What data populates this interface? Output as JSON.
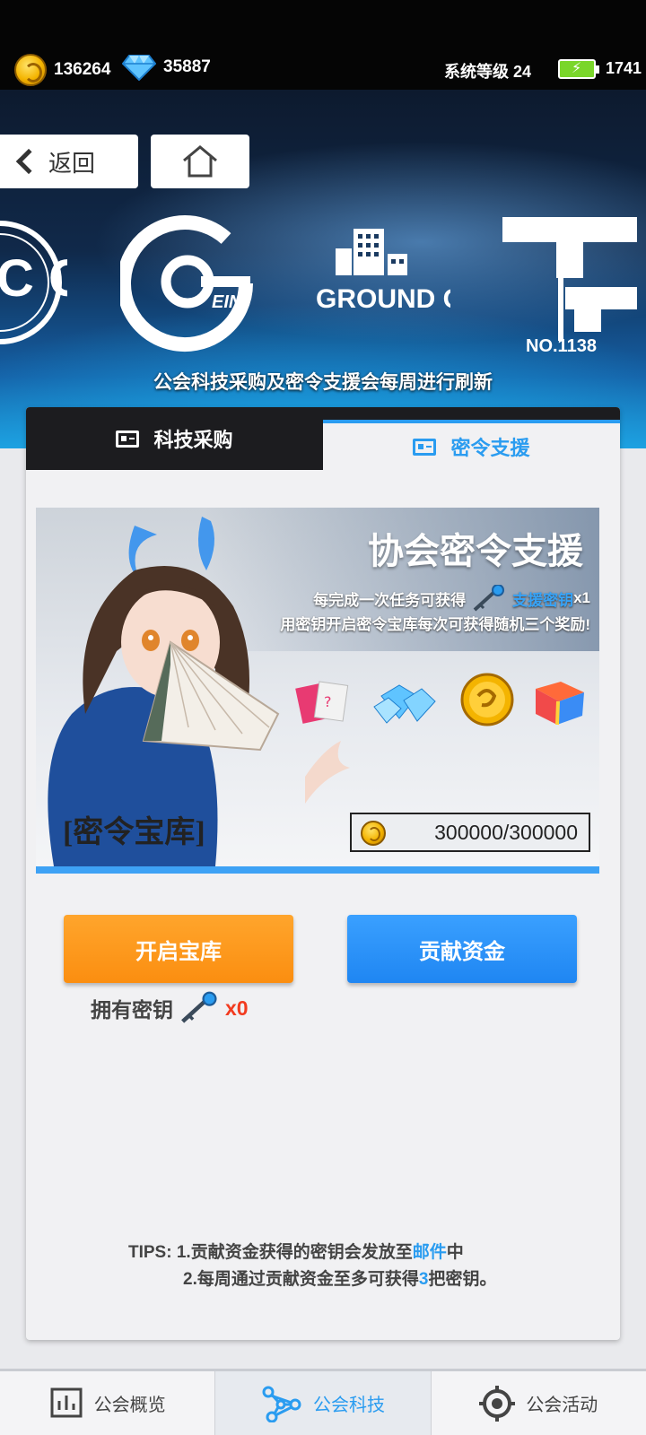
{
  "status": {
    "gold": "136264",
    "diamonds": "35887",
    "system_level": "系统等级 24",
    "energy": "1741"
  },
  "header": {
    "back_label": "返回",
    "notice": "公会科技采购及密令支援会每周进行刷新",
    "logos": [
      "C COLLEGE",
      "EIN",
      "GROUND GRAY.",
      "NO.1138"
    ]
  },
  "tabs": [
    {
      "label": "科技采购",
      "active": false
    },
    {
      "label": "密令支援",
      "active": true
    }
  ],
  "vault": {
    "title": "协会密令支援",
    "line1_prefix": "每完成一次任务可获得",
    "line1_item": "支援密钥",
    "line1_suffix": "x1",
    "line2": "用密钥开启密令宝库每次可获得随机三个奖励!",
    "name": "[密令宝库]",
    "fund_progress": "300000/300000",
    "fund_current": 300000,
    "fund_max": 300000
  },
  "actions": {
    "open_label": "开启宝库",
    "contribute_label": "贡献资金",
    "owned_label": "拥有密钥",
    "owned_count": "x0"
  },
  "tips": {
    "prefix": "TIPS:",
    "line1_a": "1.贡献资金获得的密钥会发放至",
    "line1_link": "邮件",
    "line1_b": "中",
    "line2_a": "2.每周通过贡献资金至多可获得",
    "line2_num": "3",
    "line2_b": "把密钥。"
  },
  "bottom_nav": [
    {
      "label": "公会概览",
      "icon": "chart-icon",
      "active": false
    },
    {
      "label": "公会科技",
      "icon": "network-icon",
      "active": true
    },
    {
      "label": "公会活动",
      "icon": "target-icon",
      "active": false
    }
  ],
  "colors": {
    "accent_blue": "#2a9cf0",
    "orange_button": "#fb8e10",
    "count_red": "#f23b1f"
  }
}
